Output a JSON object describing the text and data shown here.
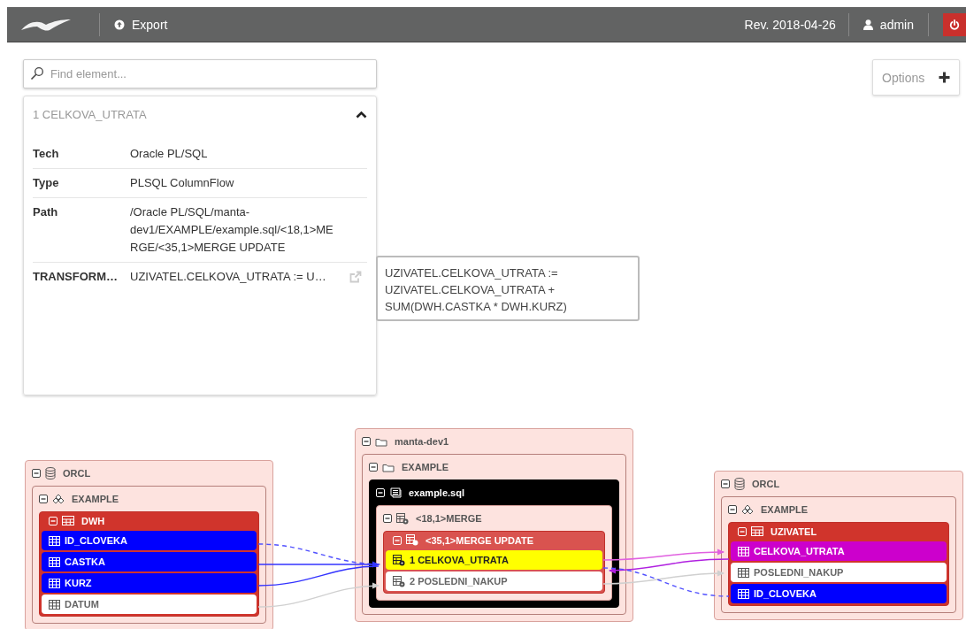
{
  "topbar": {
    "export_label": "Export",
    "revision": "Rev. 2018-04-26",
    "user": "admin"
  },
  "search": {
    "placeholder": "Find element..."
  },
  "detail": {
    "title": "1 CELKOVA_UTRATA",
    "expanded": true,
    "properties": [
      {
        "label": "Tech",
        "value": "Oracle PL/SQL",
        "kind": "text"
      },
      {
        "label": "Type",
        "value": "PLSQL ColumnFlow",
        "kind": "text"
      },
      {
        "label": "Path",
        "value": "/Oracle PL/SQL/manta-dev1/EXAMPLE/example.sql/<18,1>MERGE/<35,1>MERGE UPDATE",
        "kind": "text"
      },
      {
        "label": "TRANSFORM…",
        "value": "UZIVATEL.CELKOVA_UTRATA := U…",
        "kind": "expression"
      }
    ]
  },
  "tooltip": {
    "text": "UZIVATEL.CELKOVA_UTRATA := UZIVATEL.CELKOVA_UTRATA + SUM(DWH.CASTKA * DWH.KURZ)"
  },
  "options": {
    "label": "Options"
  },
  "diagram": {
    "groups": [
      {
        "kind": "database",
        "label": "ORCL",
        "expanded": true,
        "children": [
          {
            "kind": "schema",
            "label": "EXAMPLE",
            "expanded": true,
            "children": [
              {
                "kind": "table",
                "label": "DWH",
                "expanded": true,
                "children": [
                  {
                    "kind": "column",
                    "label": "ID_CLOVEKA",
                    "color": "#0000ff"
                  },
                  {
                    "kind": "column",
                    "label": "CASTKA",
                    "color": "#0000ff"
                  },
                  {
                    "kind": "column",
                    "label": "KURZ",
                    "color": "#0000ff"
                  },
                  {
                    "kind": "column",
                    "label": "DATUM",
                    "color": "#ffffff"
                  }
                ]
              }
            ]
          }
        ]
      },
      {
        "kind": "folder",
        "label": "manta-dev1",
        "expanded": true,
        "children": [
          {
            "kind": "folder",
            "label": "EXAMPLE",
            "expanded": true,
            "children": [
              {
                "kind": "file",
                "label": "example.sql",
                "expanded": true,
                "children": [
                  {
                    "kind": "statement",
                    "label": "<18,1>MERGE",
                    "expanded": true,
                    "children": [
                      {
                        "kind": "operation",
                        "label": "<35,1>MERGE UPDATE",
                        "expanded": true,
                        "children": [
                          {
                            "kind": "attribute",
                            "label": "1 CELKOVA_UTRATA",
                            "color": "#ffff00"
                          },
                          {
                            "kind": "attribute",
                            "label": "2 POSLEDNI_NAKUP",
                            "color": "#ffffff"
                          }
                        ]
                      }
                    ]
                  }
                ]
              }
            ]
          }
        ]
      },
      {
        "kind": "database",
        "label": "ORCL",
        "expanded": true,
        "children": [
          {
            "kind": "schema",
            "label": "EXAMPLE",
            "expanded": true,
            "children": [
              {
                "kind": "table",
                "label": "UZIVATEL",
                "expanded": true,
                "children": [
                  {
                    "kind": "column",
                    "label": "CELKOVA_UTRATA",
                    "color": "#cc00cc"
                  },
                  {
                    "kind": "column",
                    "label": "POSLEDNI_NAKUP",
                    "color": "#ffffff"
                  },
                  {
                    "kind": "column",
                    "label": "ID_CLOVEKA",
                    "color": "#0000ff"
                  }
                ]
              }
            ]
          }
        ]
      }
    ]
  }
}
